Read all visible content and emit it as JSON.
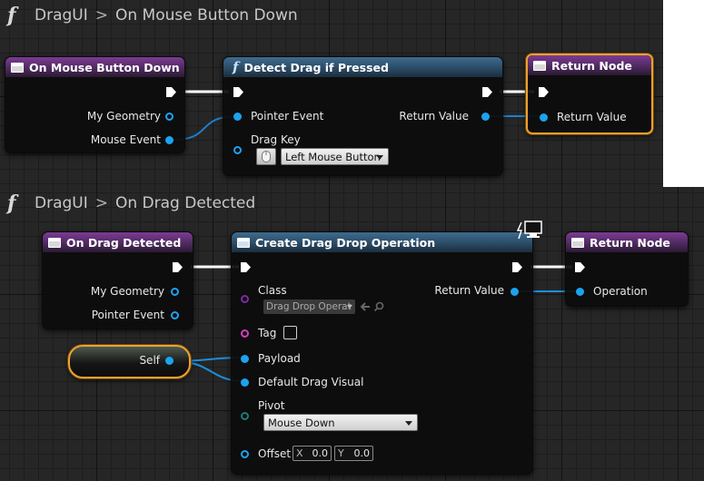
{
  "graph1": {
    "breadcrumb": {
      "blueprint": "DragUI",
      "separator": ">",
      "function": "On Mouse Button Down"
    },
    "event_node": {
      "title": "On Mouse Button Down",
      "pins": [
        "My Geometry",
        "Mouse Event"
      ]
    },
    "func_node": {
      "title": "Detect Drag if Pressed",
      "inputs": [
        "Pointer Event",
        "Drag Key"
      ],
      "outputs": [
        "Return Value"
      ],
      "drag_key_value": "Left Mouse Button"
    },
    "return_node": {
      "title": "Return Node",
      "pins": [
        "Return Value"
      ]
    }
  },
  "graph2": {
    "breadcrumb": {
      "blueprint": "DragUI",
      "separator": ">",
      "function": "On Drag Detected"
    },
    "event_node": {
      "title": "On Drag Detected",
      "pins": [
        "My Geometry",
        "Pointer Event"
      ]
    },
    "self_node": {
      "label": "Self"
    },
    "create_node": {
      "title": "Create Drag Drop Operation",
      "inputs": {
        "class_label": "Class",
        "class_value": "Drag Drop Operat",
        "tag_label": "Tag",
        "payload_label": "Payload",
        "default_drag_visual_label": "Default Drag Visual",
        "pivot_label": "Pivot",
        "pivot_value": "Mouse Down",
        "offset_label": "Offset",
        "offset_x_axis": "X",
        "offset_x": "0.0",
        "offset_y_axis": "Y",
        "offset_y": "0.0"
      },
      "outputs": {
        "return_value": "Return Value"
      }
    },
    "return_node": {
      "title": "Return Node",
      "pins": [
        "Operation"
      ]
    }
  },
  "colors": {
    "event_header": "#7d3b94",
    "function_header": "#3e6b8e",
    "pin_object": "#1ca3f0",
    "selection_outline": "#f0a030"
  },
  "icons": [
    "function-icon",
    "event-icon",
    "exec-pin-icon",
    "network-icon",
    "mouse-icon",
    "arrow-left-icon",
    "search-icon"
  ]
}
